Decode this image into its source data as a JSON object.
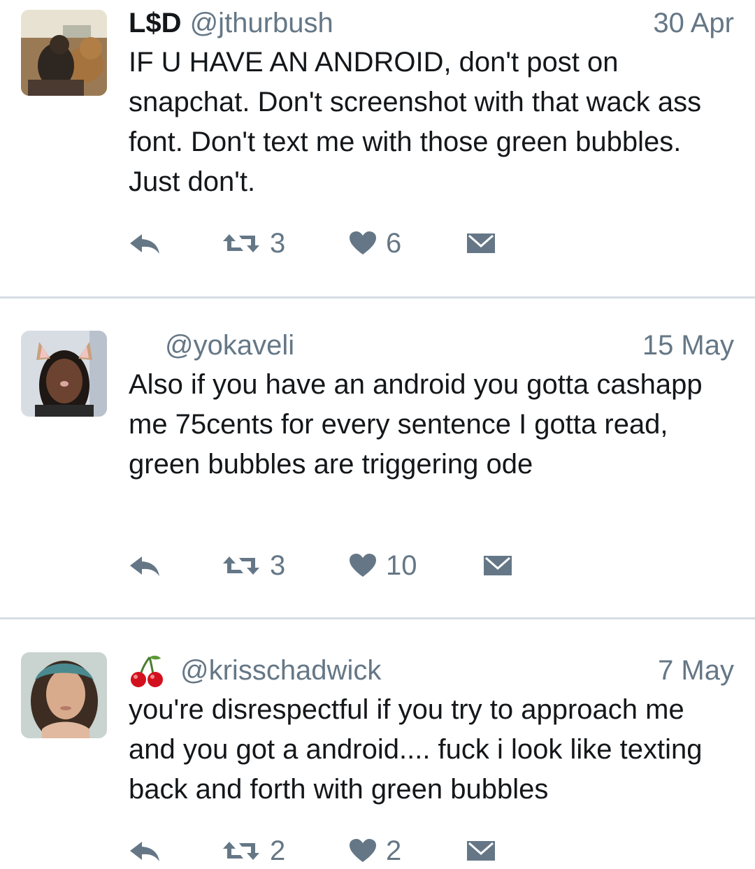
{
  "tweets": [
    {
      "name": "L$D",
      "handle": "@jthurbush",
      "date": "30 Apr",
      "text": "IF U HAVE AN ANDROID, don't post on snapchat. Don't screenshot with that wack ass font. Don't text me with those green bubbles. Just don't.",
      "retweets": "3",
      "likes": "6"
    },
    {
      "name": "",
      "handle": "@yokaveli",
      "date": "15 May",
      "text": "Also if you have an android you gotta cashapp me 75cents for every sentence I gotta read, green bubbles are triggering ode",
      "retweets": "3",
      "likes": "10"
    },
    {
      "name": "",
      "handle": "@krisschadwick",
      "date": "7 May",
      "name_emoji": "cherry-icon",
      "text": "you're disrespectful if you try to approach me and you got a android.... fuck i look like texting back and forth with green bubbles",
      "retweets": "2",
      "likes": "2"
    }
  ],
  "icons": {
    "reply": "reply-icon",
    "retweet": "retweet-icon",
    "like": "heart-icon",
    "dm": "envelope-icon"
  },
  "colors": {
    "text": "#14171a",
    "secondary": "#657786",
    "divider": "#d6dde3"
  }
}
